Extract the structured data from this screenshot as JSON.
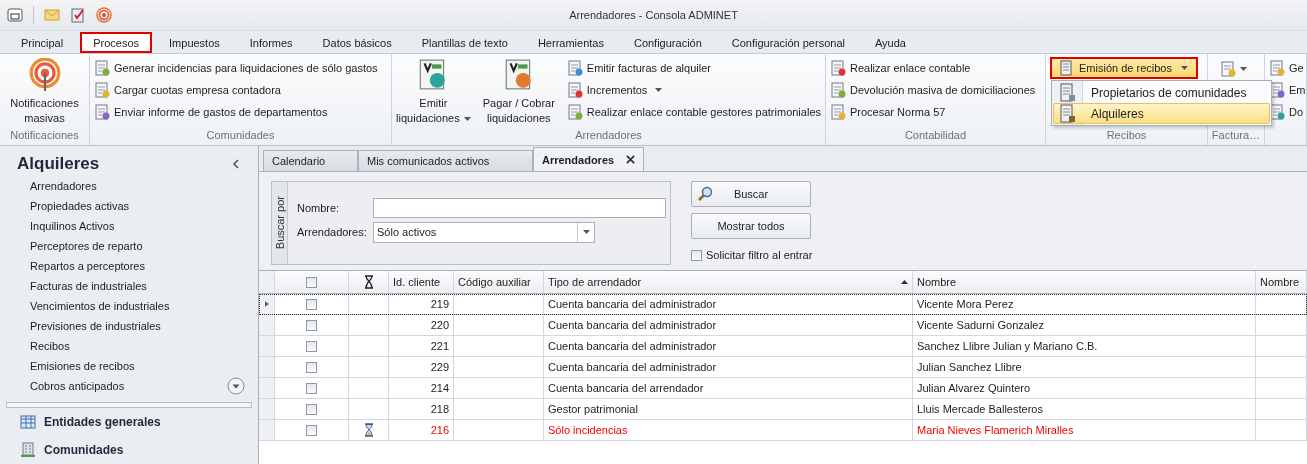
{
  "window": {
    "title": "Arrendadores - Consola ADMINET"
  },
  "ribbon_tabs": [
    {
      "label": "Principal",
      "selected": false
    },
    {
      "label": "Procesos",
      "selected": true
    },
    {
      "label": "Impuestos",
      "selected": false
    },
    {
      "label": "Informes",
      "selected": false
    },
    {
      "label": "Datos básicos",
      "selected": false
    },
    {
      "label": "Plantillas de texto",
      "selected": false
    },
    {
      "label": "Herramientas",
      "selected": false
    },
    {
      "label": "Configuración",
      "selected": false
    },
    {
      "label": "Configuración personal",
      "selected": false
    },
    {
      "label": "Ayuda",
      "selected": false
    }
  ],
  "ribbon_groups": [
    {
      "label": "Notificaciones",
      "items": [
        {
          "kind": "large",
          "label": "Notificaciones masivas",
          "dropdown": false
        }
      ]
    },
    {
      "label": "Comunidades",
      "items": [
        {
          "kind": "small",
          "label": "Generar incidencias para liquidaciones de sólo gastos",
          "dropdown": false
        },
        {
          "kind": "small",
          "label": "Cargar cuotas empresa contadora",
          "dropdown": false
        },
        {
          "kind": "small",
          "label": "Enviar informe de gastos de departamentos",
          "dropdown": false
        }
      ]
    },
    {
      "label": "Arrendadores",
      "items": [
        {
          "kind": "large",
          "label": "Emitir liquidaciones",
          "dropdown": true
        },
        {
          "kind": "large",
          "label": "Pagar / Cobrar liquidaciones",
          "dropdown": false
        },
        {
          "kind": "small",
          "label": "Emitir facturas de alquiler",
          "dropdown": false
        },
        {
          "kind": "small",
          "label": "Incrementos",
          "dropdown": true
        },
        {
          "kind": "small",
          "label": "Realizar enlace contable gestores patrimoniales",
          "dropdown": false
        }
      ]
    },
    {
      "label": "Contabilidad",
      "items": [
        {
          "kind": "small",
          "label": "Realizar enlace contable",
          "dropdown": false
        },
        {
          "kind": "small",
          "label": "Devolución masiva de domiciliaciones",
          "dropdown": false
        },
        {
          "kind": "small",
          "label": "Procesar Norma 57",
          "dropdown": false
        }
      ]
    },
    {
      "label": "Recibos",
      "items": [
        {
          "kind": "menu",
          "label": "Emisión de recibos",
          "dropdown": true,
          "expanded": true,
          "menu": [
            {
              "label": "Propietarios de comunidades",
              "selected": false
            },
            {
              "label": "Alquileres",
              "selected": true
            }
          ]
        }
      ]
    },
    {
      "label": "Factura…",
      "items": [
        {
          "kind": "icon",
          "dropdown": true
        }
      ]
    },
    {
      "items": [
        {
          "kind": "small",
          "label": "Ge",
          "dropdown": false
        },
        {
          "kind": "small",
          "label": "Em",
          "dropdown": false
        },
        {
          "kind": "small",
          "label": "Do",
          "dropdown": false
        }
      ]
    }
  ],
  "sidebar": {
    "title": "Alquileres",
    "items": [
      "Arrendadores",
      "Propiedades activas",
      "Inquilinos Activos",
      "Perceptores de reparto",
      "Repartos a perceptores",
      "Facturas de industriales",
      "Vencimientos de industriales",
      "Previsiones de industriales",
      "Recibos",
      "Emisiones de recibos",
      "Cobros anticipados"
    ],
    "sections": [
      "Entidades generales",
      "Comunidades"
    ]
  },
  "doc_tabs": [
    {
      "label": "Calendario",
      "selected": false,
      "closable": false
    },
    {
      "label": "Mis comunicados activos",
      "selected": false,
      "closable": false
    },
    {
      "label": "Arrendadores",
      "selected": true,
      "closable": true
    }
  ],
  "filter": {
    "group_label": "Buscar por",
    "fields": [
      {
        "kind": "text",
        "label": "Nombre:"
      },
      {
        "kind": "combo",
        "label": "Arrendadores:",
        "value": "Sólo activos"
      }
    ],
    "buttons": [
      "Buscar",
      "Mostrar todos"
    ],
    "option": {
      "label": "Solicitar filtro al entrar",
      "checked": false
    }
  },
  "table": {
    "select_all_checked": false,
    "columns": [
      {
        "label": "Id. cliente",
        "sorted": false
      },
      {
        "label": "Código auxiliar",
        "sorted": false
      },
      {
        "label": "Tipo de arrendador",
        "sorted": true
      },
      {
        "label": "Nombre",
        "sorted": false
      },
      {
        "label": "Nombre",
        "sorted": false
      }
    ],
    "rows": [
      {
        "current": true,
        "checked": false,
        "pending": false,
        "alert": false,
        "id": "219",
        "type": "Cuenta bancaria del administrador",
        "name": "Vicente Mora Perez"
      },
      {
        "current": false,
        "checked": false,
        "pending": false,
        "alert": false,
        "id": "220",
        "type": "Cuenta bancaria del administrador",
        "name": "Vicente Sadurni Gonzalez"
      },
      {
        "current": false,
        "checked": false,
        "pending": false,
        "alert": false,
        "id": "221",
        "type": "Cuenta bancaria del administrador",
        "name": "Sanchez Llibre Julian y Mariano C.B."
      },
      {
        "current": false,
        "checked": false,
        "pending": false,
        "alert": false,
        "id": "229",
        "type": "Cuenta bancaria del administrador",
        "name": "Julian Sanchez Llibre"
      },
      {
        "current": false,
        "checked": false,
        "pending": false,
        "alert": false,
        "id": "214",
        "type": "Cuenta bancaria del arrendador",
        "name": "Julian Alvarez Quintero"
      },
      {
        "current": false,
        "checked": false,
        "pending": false,
        "alert": false,
        "id": "218",
        "type": "Gestor patrimonial",
        "name": "Lluis Mercade Ballesteros"
      },
      {
        "current": false,
        "checked": false,
        "pending": true,
        "alert": true,
        "id": "216",
        "type": "Sólo incidencias",
        "name": "Maria Nieves Flamerich Miralles"
      }
    ]
  }
}
